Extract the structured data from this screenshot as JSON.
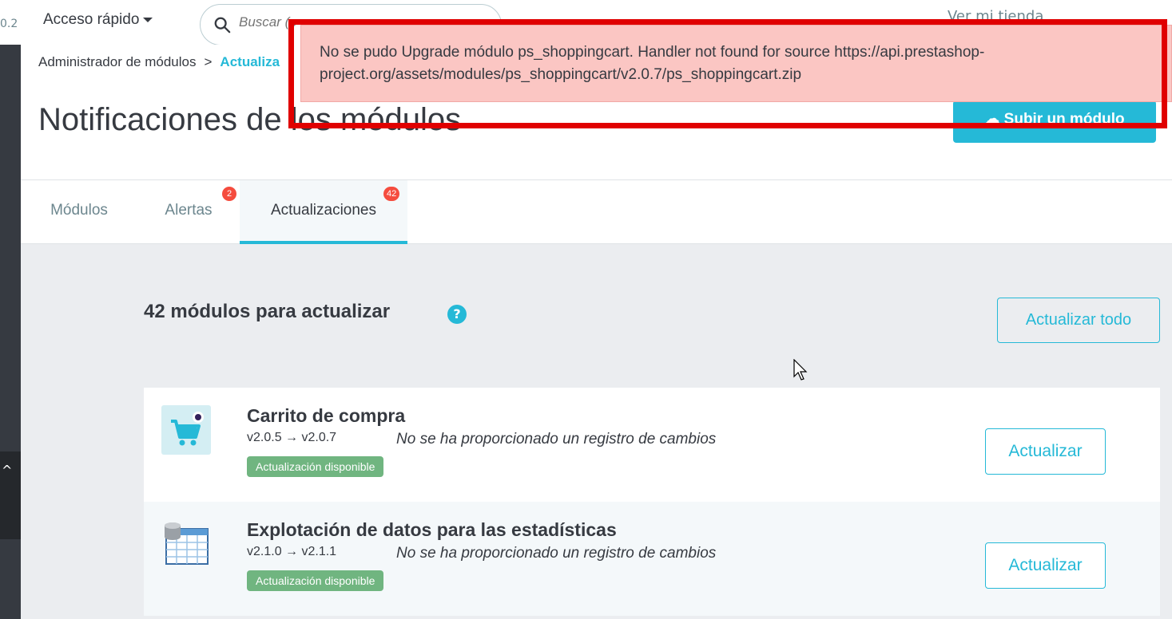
{
  "sidebar": {
    "version_fragment": "0.2",
    "collapse_label": "^"
  },
  "header": {
    "quick_access": "Acceso rápido",
    "search_placeholder": "Buscar (e",
    "right_fragment": "Ver mi tienda"
  },
  "breadcrumb": {
    "parent": "Administrador de módulos",
    "separator": ">",
    "current": "Actualiza"
  },
  "page": {
    "title": "Notificaciones de los módulos",
    "upload_label": "Subir un módulo"
  },
  "tabs": [
    {
      "label": "Módulos",
      "badge": ""
    },
    {
      "label": "Alertas",
      "badge": "2"
    },
    {
      "label": "Actualizaciones",
      "badge": "42"
    }
  ],
  "main": {
    "count_title": "42 módulos para actualizar",
    "help": "?",
    "update_all_label": "Actualizar todo"
  },
  "modules": [
    {
      "name": "Carrito de compra",
      "version": "v2.0.5 → v2.0.7",
      "changelog": "No se ha proporcionado un registro de cambios",
      "status": "Actualización disponible",
      "action": "Actualizar"
    },
    {
      "name": "Explotación de datos para las estadísticas",
      "version": "v2.1.0 → v2.1.1",
      "changelog": "No se ha proporcionado un registro de cambios",
      "status": "Actualización disponible",
      "action": "Actualizar"
    }
  ],
  "alert": {
    "message": "No se pudo Upgrade módulo ps_shoppingcart. Handler not found for source https://api.prestashop-project.org/assets/modules/ps_shoppingcart/v2.0.7/ps_shoppingcart.zip"
  },
  "colors": {
    "accent": "#25b9d7",
    "success": "#70b580",
    "danger_bg": "#fbc6c3",
    "danger_frame": "#e00000",
    "badge": "#f54c3e"
  }
}
